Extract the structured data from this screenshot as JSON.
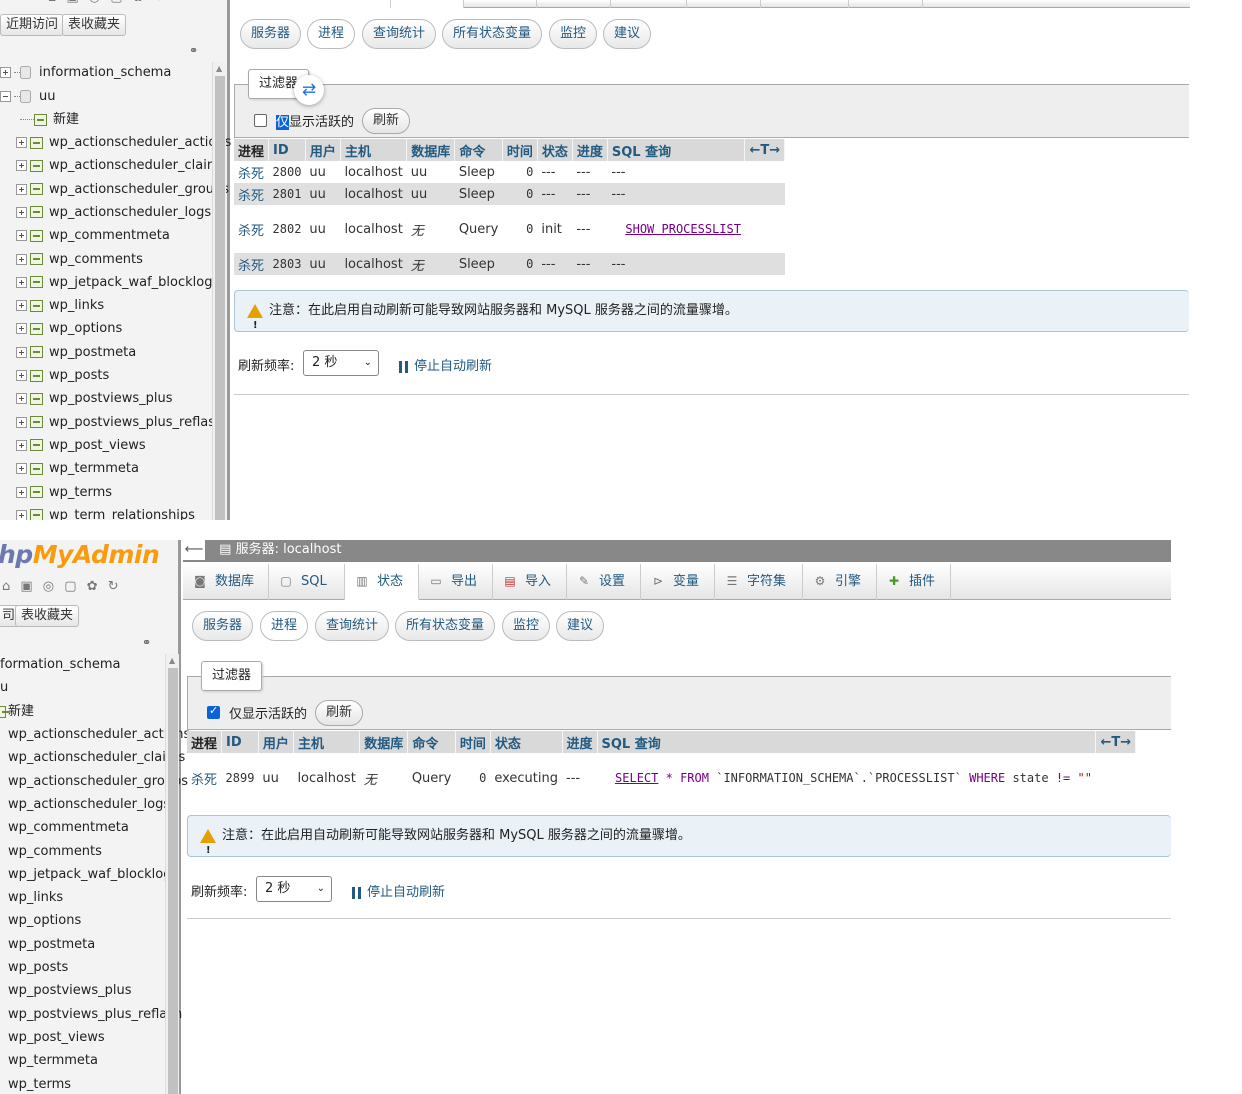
{
  "colors": {
    "link": "#235a81",
    "accent": "#0b62d6",
    "warning": "#e5a100",
    "notice_bg": "#eaf1f7",
    "logo_blue": "#6c78af",
    "logo_orange": "#f89c0e"
  },
  "p1": {
    "nav": {
      "tabs": [
        "近期访问",
        "表收藏夹"
      ],
      "dbs": [
        "information_schema",
        "uu"
      ],
      "new_label": "新建",
      "tables": [
        "wp_actionscheduler_actions",
        "wp_actionscheduler_claims",
        "wp_actionscheduler_groups",
        "wp_actionscheduler_logs",
        "wp_commentmeta",
        "wp_comments",
        "wp_jetpack_waf_blocklog",
        "wp_links",
        "wp_options",
        "wp_postmeta",
        "wp_posts",
        "wp_postviews_plus",
        "wp_postviews_plus_reflash",
        "wp_post_views",
        "wp_termmeta",
        "wp_terms",
        "wp_term_relationships"
      ]
    },
    "subtabs": [
      "服务器",
      "进程",
      "查询统计",
      "所有状态变量",
      "监控",
      "建议"
    ],
    "filter": {
      "legend": "过滤器",
      "active_only_first": "仅",
      "active_only_rest": "显示活跃的",
      "refresh": "刷新",
      "checked": false
    },
    "table": {
      "headers": [
        "进程",
        "ID",
        "用户",
        "主机",
        "数据库",
        "命令",
        "时间",
        "状态",
        "进度",
        "SQL 查询",
        "←T→"
      ],
      "rows": [
        {
          "kill": "杀死",
          "id": "2800",
          "user": "uu",
          "host": "localhost",
          "db": "uu",
          "cmd": "Sleep",
          "time": "0",
          "state": "---",
          "progress": "---",
          "sql": "---"
        },
        {
          "kill": "杀死",
          "id": "2801",
          "user": "uu",
          "host": "localhost",
          "db": "uu",
          "cmd": "Sleep",
          "time": "0",
          "state": "---",
          "progress": "---",
          "sql": "---"
        },
        {
          "kill": "杀死",
          "id": "2802",
          "user": "uu",
          "host": "localhost",
          "db": "无",
          "cmd": "Query",
          "time": "0",
          "state": "init",
          "progress": "---",
          "sql": "SHOW PROCESSLIST"
        },
        {
          "kill": "杀死",
          "id": "2803",
          "user": "uu",
          "host": "localhost",
          "db": "无",
          "cmd": "Sleep",
          "time": "0",
          "state": "---",
          "progress": "---",
          "sql": "---"
        }
      ]
    },
    "notice": "注意：在此启用自动刷新可能导致网站服务器和 MySQL 服务器之间的流量骤增。",
    "refresh_rate_label": "刷新频率:",
    "refresh_rate_value": "2 秒",
    "stop_refresh": "停止自动刷新"
  },
  "p2": {
    "logo_a": "hp",
    "logo_b": "MyAdmin",
    "nav": {
      "tabs": [
        "司",
        "表收藏夹"
      ],
      "dbs": [
        "formation_schema",
        "u"
      ],
      "new_label": "新建",
      "tables": [
        "wp_actionscheduler_actions",
        "wp_actionscheduler_claims",
        "wp_actionscheduler_groups",
        "wp_actionscheduler_logs",
        "wp_commentmeta",
        "wp_comments",
        "wp_jetpack_waf_blocklog",
        "wp_links",
        "wp_options",
        "wp_postmeta",
        "wp_posts",
        "wp_postviews_plus",
        "wp_postviews_plus_reflash",
        "wp_post_views",
        "wp_termmeta",
        "wp_terms"
      ]
    },
    "server_bar": "服务器: localhost",
    "topmenu": [
      {
        "label": "数据库",
        "icon": "database-icon"
      },
      {
        "label": "SQL",
        "icon": "sql-icon"
      },
      {
        "label": "状态",
        "icon": "status-icon"
      },
      {
        "label": "导出",
        "icon": "export-icon"
      },
      {
        "label": "导入",
        "icon": "import-icon"
      },
      {
        "label": "设置",
        "icon": "settings-icon"
      },
      {
        "label": "变量",
        "icon": "variables-icon"
      },
      {
        "label": "字符集",
        "icon": "charset-icon"
      },
      {
        "label": "引擎",
        "icon": "engine-icon"
      },
      {
        "label": "插件",
        "icon": "plugin-icon"
      }
    ],
    "subtabs": [
      "服务器",
      "进程",
      "查询统计",
      "所有状态变量",
      "监控",
      "建议"
    ],
    "filter": {
      "legend": "过滤器",
      "active_only": "仅显示活跃的",
      "refresh": "刷新",
      "checked": true
    },
    "table": {
      "headers": [
        "进程",
        "ID",
        "用户",
        "主机",
        "数据库",
        "命令",
        "时间",
        "状态",
        "进度",
        "SQL 查询",
        "←T→"
      ],
      "rows": [
        {
          "kill": "杀死",
          "id": "2899",
          "user": "uu",
          "host": "localhost",
          "db": "无",
          "cmd": "Query",
          "time": "0",
          "state": "executing",
          "progress": "---",
          "sql_select": "SELECT",
          "sql_star": "*",
          "sql_from": "FROM",
          "sql_table": "`INFORMATION_SCHEMA`.`PROCESSLIST`",
          "sql_where": "WHERE",
          "sql_cond": "state",
          "sql_op": "!=",
          "sql_str": "\"\""
        }
      ]
    },
    "notice": "注意：在此启用自动刷新可能导致网站服务器和 MySQL 服务器之间的流量骤增。",
    "refresh_rate_label": "刷新频率:",
    "refresh_rate_value": "2 秒",
    "stop_refresh": "停止自动刷新"
  }
}
